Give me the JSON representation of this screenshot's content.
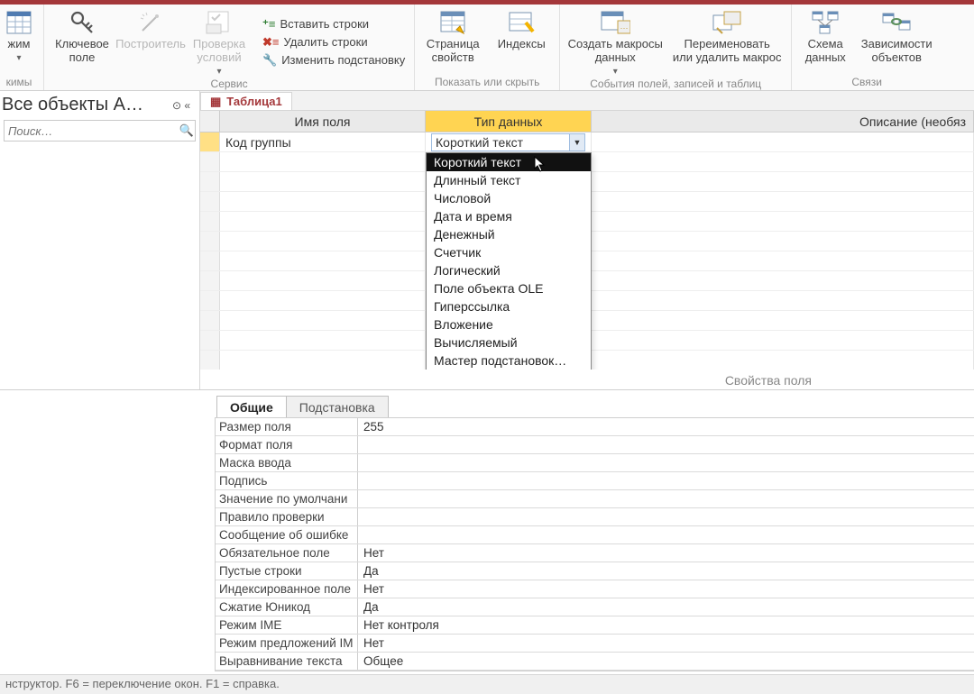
{
  "ribbon": {
    "view": {
      "label": "жим",
      "tooltip_caption": "кимы"
    },
    "key": {
      "label": "Ключевое\nполе"
    },
    "builder": {
      "label": "Построитель"
    },
    "validate": {
      "label": "Проверка\nусловий"
    },
    "svc_group_label": "Сервис",
    "insert_rows": "Вставить строки",
    "delete_rows": "Удалить строки",
    "modify_lookup": "Изменить подстановку",
    "prop_page": {
      "label": "Страница\nсвойств"
    },
    "indexes": {
      "label": "Индексы"
    },
    "show_hide_label": "Показать или скрыть",
    "create_macros": {
      "label": "Создать макросы\nданных"
    },
    "rename_macro": {
      "label": "Переименовать\nили удалить макрос"
    },
    "events_label": "События полей, записей и таблиц",
    "schema": {
      "label": "Схема\nданных"
    },
    "deps": {
      "label": "Зависимости\nобъектов"
    },
    "links_label": "Связи"
  },
  "nav": {
    "title": "Все объекты A…",
    "search_placeholder": "Поиск…"
  },
  "tab": {
    "label": "Таблица1"
  },
  "grid": {
    "headers": {
      "name": "Имя поля",
      "type": "Тип данных",
      "desc": "Описание (необяз"
    },
    "rows": [
      {
        "name": "Код группы",
        "type": "Короткий текст"
      }
    ]
  },
  "dropdown": {
    "options": [
      "Короткий текст",
      "Длинный текст",
      "Числовой",
      "Дата и время",
      "Денежный",
      "Счетчик",
      "Логический",
      "Поле объекта OLE",
      "Гиперссылка",
      "Вложение",
      "Вычисляемый",
      "Мастер подстановок…"
    ],
    "selected_index": 0
  },
  "props_caption": "Свойства поля",
  "prop_tabs": {
    "general": "Общие",
    "lookup": "Подстановка"
  },
  "properties": [
    {
      "name": "Размер поля",
      "value": "255"
    },
    {
      "name": "Формат поля",
      "value": ""
    },
    {
      "name": "Маска ввода",
      "value": ""
    },
    {
      "name": "Подпись",
      "value": ""
    },
    {
      "name": "Значение по умолчани",
      "value": ""
    },
    {
      "name": "Правило проверки",
      "value": ""
    },
    {
      "name": "Сообщение об ошибке",
      "value": ""
    },
    {
      "name": "Обязательное поле",
      "value": "Нет"
    },
    {
      "name": "Пустые строки",
      "value": "Да"
    },
    {
      "name": "Индексированное поле",
      "value": "Нет"
    },
    {
      "name": "Сжатие Юникод",
      "value": "Да"
    },
    {
      "name": "Режим IME",
      "value": "Нет контроля"
    },
    {
      "name": "Режим предложений IM",
      "value": "Нет"
    },
    {
      "name": "Выравнивание текста",
      "value": "Общее"
    }
  ],
  "statusbar": "нструктор.   F6 = переключение окон.   F1 = справка."
}
